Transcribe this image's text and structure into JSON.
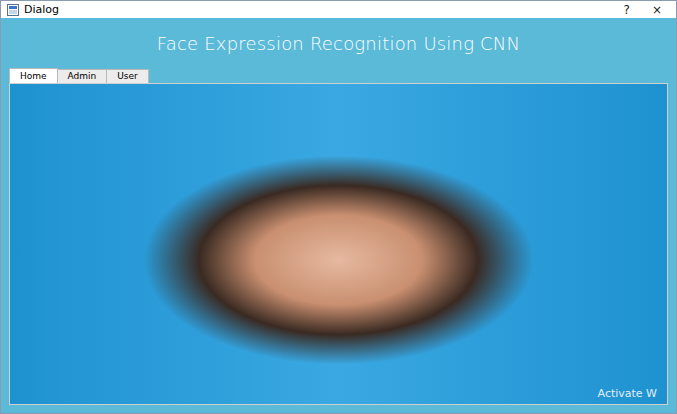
{
  "window": {
    "title": "Dialog",
    "buttons": [
      "?",
      "×"
    ]
  },
  "header": {
    "title": "Face Expression Recognition Using CNN"
  },
  "tabs": [
    {
      "label": "Home",
      "selected": true
    },
    {
      "label": "Admin",
      "selected": false
    },
    {
      "label": "User",
      "selected": false
    }
  ],
  "watermark": "Activate W"
}
